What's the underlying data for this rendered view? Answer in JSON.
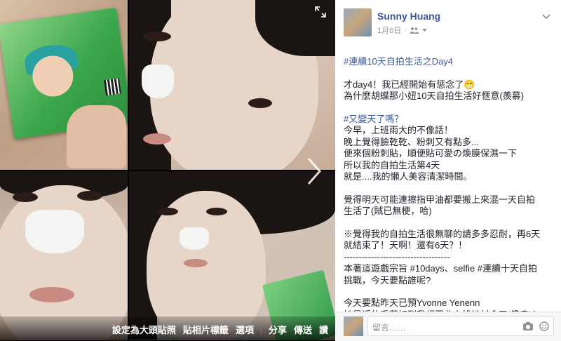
{
  "viewer": {
    "actions": [
      "設定為大頭貼照",
      "貼相片標籤",
      "選項"
    ],
    "share_actions": [
      "分享",
      "傳送",
      "讚"
    ],
    "next_icon": "chevron-right-icon",
    "expand_icon": "expand-icon"
  },
  "post": {
    "author": "Sunny Huang",
    "date": "1月6日",
    "privacy_icon": "friends-icon",
    "lines": [
      {
        "text": "#連續10天自拍生活之Day4",
        "tag": true
      },
      {
        "text": "",
        "blank": true
      },
      {
        "text": "才day4！我已經開始有惩念了😁"
      },
      {
        "text": "為什麼胡蝶那小妞10天自拍生活好愜意(羨慕)"
      },
      {
        "text": "",
        "blank": true
      },
      {
        "text": "#又變天了嗎？",
        "tag": true
      },
      {
        "text": "今早，上班雨大的不像話！"
      },
      {
        "text": "晚上覺得臉乾乾、粉刺又有點多..."
      },
      {
        "text": "便來個粉刺貼，順便貼可愛の煥膜保濕一下"
      },
      {
        "text": "所以我的自拍生活第4天"
      },
      {
        "text": "就是....我的懶人美容清潔時間。"
      },
      {
        "text": "",
        "blank": true
      },
      {
        "text": "覺得明天可能連擦指甲油都要搬上來混一天自拍"
      },
      {
        "text": "生活了(賊已無梗，哈)"
      },
      {
        "text": "",
        "blank": true
      },
      {
        "text": "※覺得我的自拍生活很無聊的請多多忍耐，再6天"
      },
      {
        "text": "就結束了！天啊！還有6天？！"
      },
      {
        "text": "-----------------------------------"
      },
      {
        "text": "本著這遊戲宗旨 #10days、selfie #連續十天自拍"
      },
      {
        "text": "挑戰，今天要點誰呢?"
      },
      {
        "text": "",
        "blank": true
      },
      {
        "text": "今天要點昨天已預Yvonne Yenenn"
      },
      {
        "text": "她最近的手藝好到我想要北上找她討食了(饞鬼)！"
      }
    ]
  },
  "comment": {
    "placeholder": "留言……",
    "icons": [
      "camera-icon",
      "emoji-icon"
    ]
  }
}
